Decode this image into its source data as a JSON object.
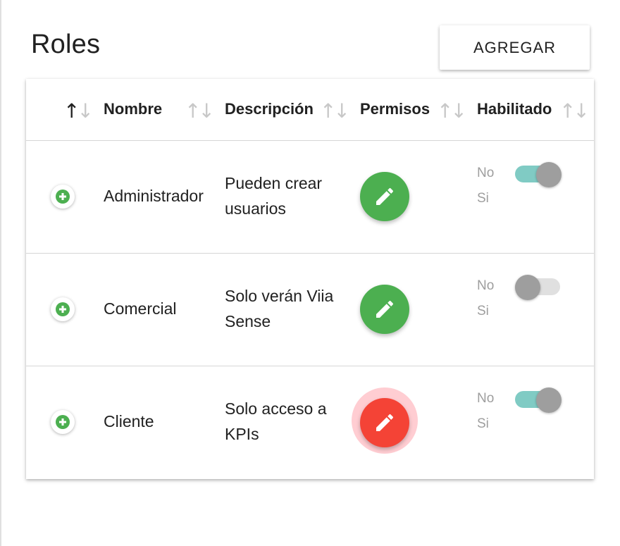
{
  "page": {
    "title": "Roles",
    "add_button_label": "AGREGAR"
  },
  "table": {
    "columns": [
      {
        "label": "",
        "sort": "ascending"
      },
      {
        "label": "Nombre",
        "sort": "none"
      },
      {
        "label": "Descripción",
        "sort": "none"
      },
      {
        "label": "Permisos",
        "sort": "none"
      },
      {
        "label": "Habilitado",
        "sort": "none"
      }
    ],
    "rows": [
      {
        "nombre": "Administrador",
        "descripcion": "Pueden crear usuarios",
        "permisos_color": "#4caf50",
        "habilitado": true,
        "label_no": "No",
        "label_si": "Si"
      },
      {
        "nombre": "Comercial",
        "descripcion": "Solo verán Viia Sense",
        "permisos_color": "#4caf50",
        "habilitado": false,
        "label_no": "No",
        "label_si": "Si"
      },
      {
        "nombre": "Cliente",
        "descripcion": "Solo acceso a KPIs",
        "permisos_color": "#f44336",
        "habilitado": true,
        "label_no": "No",
        "label_si": "Si"
      }
    ]
  },
  "icons": {
    "sort": "sort-arrows-icon",
    "expand": "add-circle-icon",
    "permissions": "pencil-icon"
  },
  "colors": {
    "expand_green": "#4caf50",
    "edit_green": "#4caf50",
    "edit_red": "#f44336",
    "switch_track_on": "#80cbc4",
    "switch_thumb": "#9e9e9e"
  }
}
